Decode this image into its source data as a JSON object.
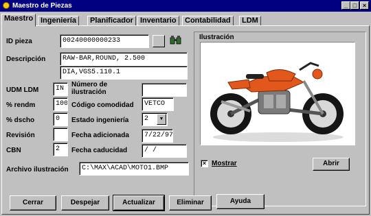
{
  "window": {
    "title": "Maestro de Piezas",
    "controls": [
      "_",
      "□",
      "×"
    ]
  },
  "tabs": [
    {
      "label": "Maestro",
      "active": true
    },
    {
      "label": "Ingeniería",
      "active": false
    },
    {
      "label": "Planificador",
      "active": false
    },
    {
      "label": "Inventario",
      "active": false
    },
    {
      "label": "Contabilidad",
      "active": false
    },
    {
      "label": "LDM",
      "active": false
    }
  ],
  "form": {
    "id_pieza": {
      "label": "ID pieza",
      "value": "00240000000233"
    },
    "descripcion": {
      "label": "Descripción",
      "line1": "RAW-BAR,ROUND, 2.500",
      "line2": "DIA,VGS5.110.1"
    },
    "udm_ldm": {
      "label": "UDM LDM",
      "value": "IN"
    },
    "numero_ilustracion": {
      "label_line1": "Número de",
      "label_line2": "ilustración",
      "value": ""
    },
    "rendm": {
      "label": "% rendm",
      "value": "100"
    },
    "codigo_comodidad": {
      "label": "Código comodidad",
      "value": "VETCO"
    },
    "dscho": {
      "label": "% dscho",
      "value": "0"
    },
    "estado_ingenieria": {
      "label": "Estado ingeniería",
      "value": "2"
    },
    "revision": {
      "label": "Revisión",
      "value": ""
    },
    "fecha_adicionada": {
      "label": "Fecha adicionada",
      "value": "7/22/97"
    },
    "cbn": {
      "label": "CBN",
      "value": "2"
    },
    "fecha_caducidad": {
      "label": "Fecha caducidad",
      "value": "/ /"
    },
    "archivo_ilustracion": {
      "label": "Archivo ilustración",
      "value": "C:\\MAX\\ACAD\\MOTO1.BMP"
    }
  },
  "illustration": {
    "group_label": "Ilustración",
    "mostrar_label": "Mostrar",
    "mostrar_checked": "×",
    "abrir_label": "Abrir"
  },
  "buttons": {
    "cerrar": "Cerrar",
    "despejar": "Despejar",
    "actualizar": "Actualizar",
    "eliminar": "Eliminar",
    "ayuda": "Ayuda"
  },
  "colors": {
    "titlebar": "#000080",
    "face": "#c0c0c0",
    "bike_body": "#e2571c"
  }
}
